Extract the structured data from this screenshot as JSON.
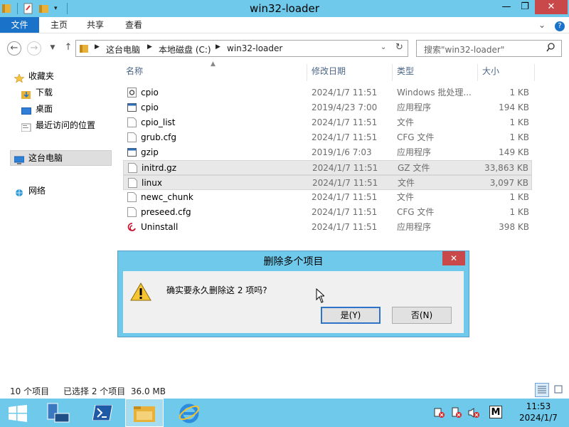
{
  "window": {
    "title": "win32-loader",
    "min": "—",
    "max": "❐",
    "close": "✕"
  },
  "ribbon": {
    "tabs": [
      "文件",
      "主页",
      "共享",
      "查看"
    ],
    "expand": "⌄",
    "help": "?"
  },
  "address": {
    "segments": [
      "这台电脑",
      "本地磁盘 (C:)",
      "win32-loader"
    ],
    "search_placeholder": "搜索\"win32-loader\""
  },
  "nav": {
    "favorites": "收藏夹",
    "downloads": "下载",
    "desktop": "桌面",
    "recent": "最近访问的位置",
    "thispc": "这台电脑",
    "network": "网络"
  },
  "columns": {
    "name": "名称",
    "date": "修改日期",
    "type": "类型",
    "size": "大小"
  },
  "files": [
    {
      "name": "cpio",
      "date": "2024/1/7 11:51",
      "type": "Windows 批处理...",
      "size": "1 KB",
      "icon": "batch-file-icon",
      "selected": false
    },
    {
      "name": "cpio",
      "date": "2019/4/23 7:00",
      "type": "应用程序",
      "size": "194 KB",
      "icon": "application-icon",
      "selected": false
    },
    {
      "name": "cpio_list",
      "date": "2024/1/7 11:51",
      "type": "文件",
      "size": "1 KB",
      "icon": "file-icon",
      "selected": false
    },
    {
      "name": "grub.cfg",
      "date": "2024/1/7 11:51",
      "type": "CFG 文件",
      "size": "1 KB",
      "icon": "file-icon",
      "selected": false
    },
    {
      "name": "gzip",
      "date": "2019/1/6 7:03",
      "type": "应用程序",
      "size": "149 KB",
      "icon": "application-icon",
      "selected": false
    },
    {
      "name": "initrd.gz",
      "date": "2024/1/7 11:51",
      "type": "GZ 文件",
      "size": "33,863 KB",
      "icon": "file-icon",
      "selected": true
    },
    {
      "name": "linux",
      "date": "2024/1/7 11:51",
      "type": "文件",
      "size": "3,097 KB",
      "icon": "file-icon",
      "selected": true
    },
    {
      "name": "newc_chunk",
      "date": "2024/1/7 11:51",
      "type": "文件",
      "size": "1 KB",
      "icon": "file-icon",
      "selected": false
    },
    {
      "name": "preseed.cfg",
      "date": "2024/1/7 11:51",
      "type": "CFG 文件",
      "size": "1 KB",
      "icon": "file-icon",
      "selected": false
    },
    {
      "name": "Uninstall",
      "date": "2024/1/7 11:51",
      "type": "应用程序",
      "size": "398 KB",
      "icon": "debian-swirl-icon",
      "selected": false
    }
  ],
  "dialog": {
    "title": "删除多个项目",
    "close": "✕",
    "message": "确实要永久删除这 2 项吗?",
    "yes": "是(Y)",
    "no": "否(N)"
  },
  "status": {
    "count": "10 个项目",
    "selected": "已选择 2 个项目  36.0 MB"
  },
  "taskbar": {
    "time": "11:53",
    "date": "2024/1/7",
    "ime": "M"
  },
  "colors": {
    "titlebar": "#6ec9ea",
    "file_tab": "#1a73c8",
    "close_red": "#c9494a",
    "selection": "#e8e8e8"
  }
}
